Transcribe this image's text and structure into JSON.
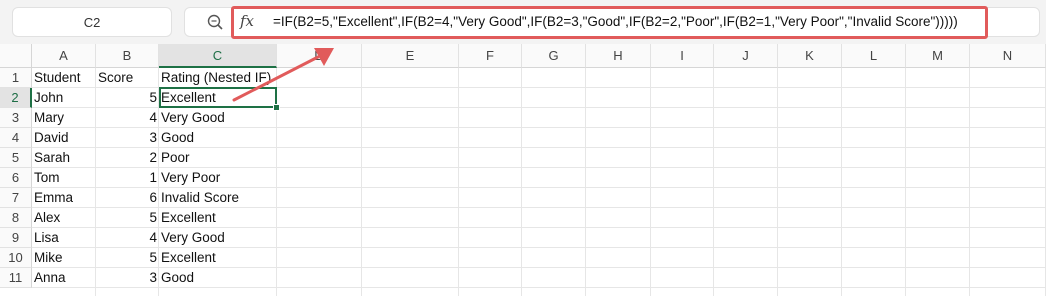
{
  "name_box": "C2",
  "formula_bar": {
    "fx_label": "fx",
    "formula": "=IF(B2=5,\"Excellent\",IF(B2=4,\"Very Good\",IF(B2=3,\"Good\",IF(B2=2,\"Poor\",IF(B2=1,\"Very Poor\",\"Invalid Score\")))))"
  },
  "columns": [
    "A",
    "B",
    "C",
    "D",
    "E",
    "F",
    "G",
    "H",
    "I",
    "J",
    "K",
    "L",
    "M",
    "N"
  ],
  "active_column": "C",
  "active_row": "2",
  "rows": [
    "1",
    "2",
    "3",
    "4",
    "5",
    "6",
    "7",
    "8",
    "9",
    "10",
    "11"
  ],
  "header_row": {
    "a": "Student",
    "b": "Score",
    "c": "Rating (Nested IF)"
  },
  "data_rows": [
    {
      "a": "John",
      "b": "5",
      "c": "Excellent"
    },
    {
      "a": "Mary",
      "b": "4",
      "c": "Very Good"
    },
    {
      "a": "David",
      "b": "3",
      "c": "Good"
    },
    {
      "a": "Sarah",
      "b": "2",
      "c": "Poor"
    },
    {
      "a": "Tom",
      "b": "1",
      "c": "Very Poor"
    },
    {
      "a": "Emma",
      "b": "6",
      "c": "Invalid Score"
    },
    {
      "a": "Alex",
      "b": "5",
      "c": "Excellent"
    },
    {
      "a": "Lisa",
      "b": "4",
      "c": "Very Good"
    },
    {
      "a": "Mike",
      "b": "5",
      "c": "Excellent"
    },
    {
      "a": "Anna",
      "b": "3",
      "c": "Good"
    }
  ],
  "colors": {
    "highlight": "#e15b5b",
    "selection": "#1e7145"
  },
  "icons": {
    "zoom": "zoom-icon"
  }
}
